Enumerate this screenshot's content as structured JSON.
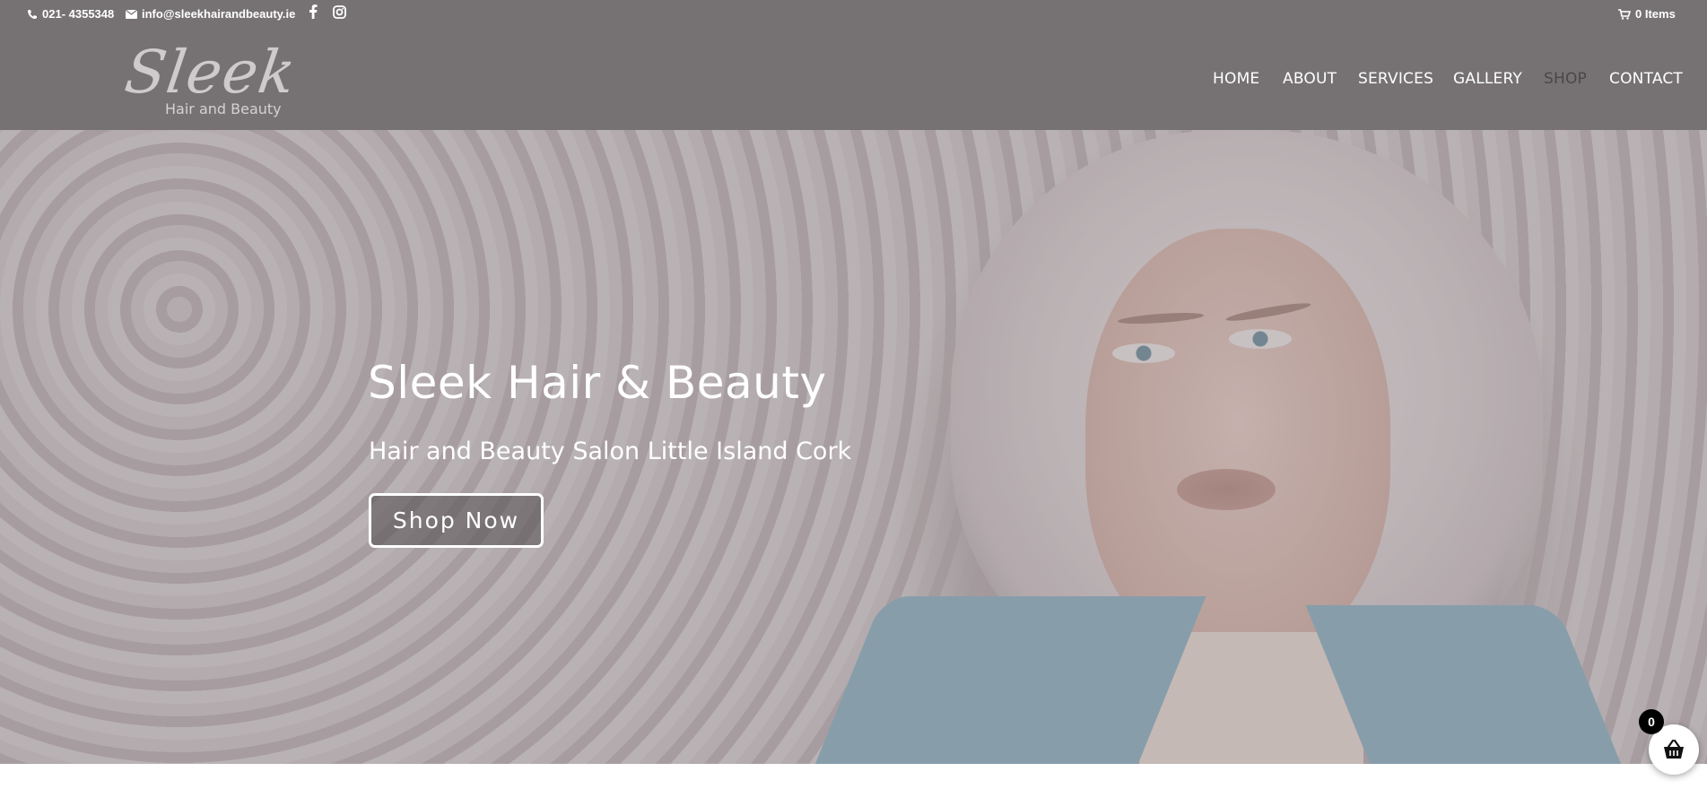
{
  "top_bar": {
    "phone": "021- 4355348",
    "email": "info@sleekhairandbeauty.ie",
    "social": [
      "facebook-icon",
      "instagram-icon"
    ],
    "cart_label": "0 Items"
  },
  "header": {
    "logo": {
      "script": "Sleek",
      "subtitle": "Hair and Beauty"
    },
    "nav": [
      {
        "label": "HOME",
        "active": false
      },
      {
        "label": "ABOUT",
        "active": false
      },
      {
        "label": "SERVICES",
        "active": false
      },
      {
        "label": "GALLERY",
        "active": false
      },
      {
        "label": "SHOP",
        "active": true
      },
      {
        "label": "CONTACT",
        "active": false
      }
    ]
  },
  "hero": {
    "title": "Sleek Hair & Beauty",
    "subtitle": "Hair and Beauty Salon Little Island Cork",
    "cta_label": "Shop Now"
  },
  "floating_cart": {
    "count": "0",
    "icon": "basket-icon"
  },
  "colors": {
    "header_bg": "#767273",
    "active_nav": "#4a4748",
    "text": "#ffffff"
  }
}
